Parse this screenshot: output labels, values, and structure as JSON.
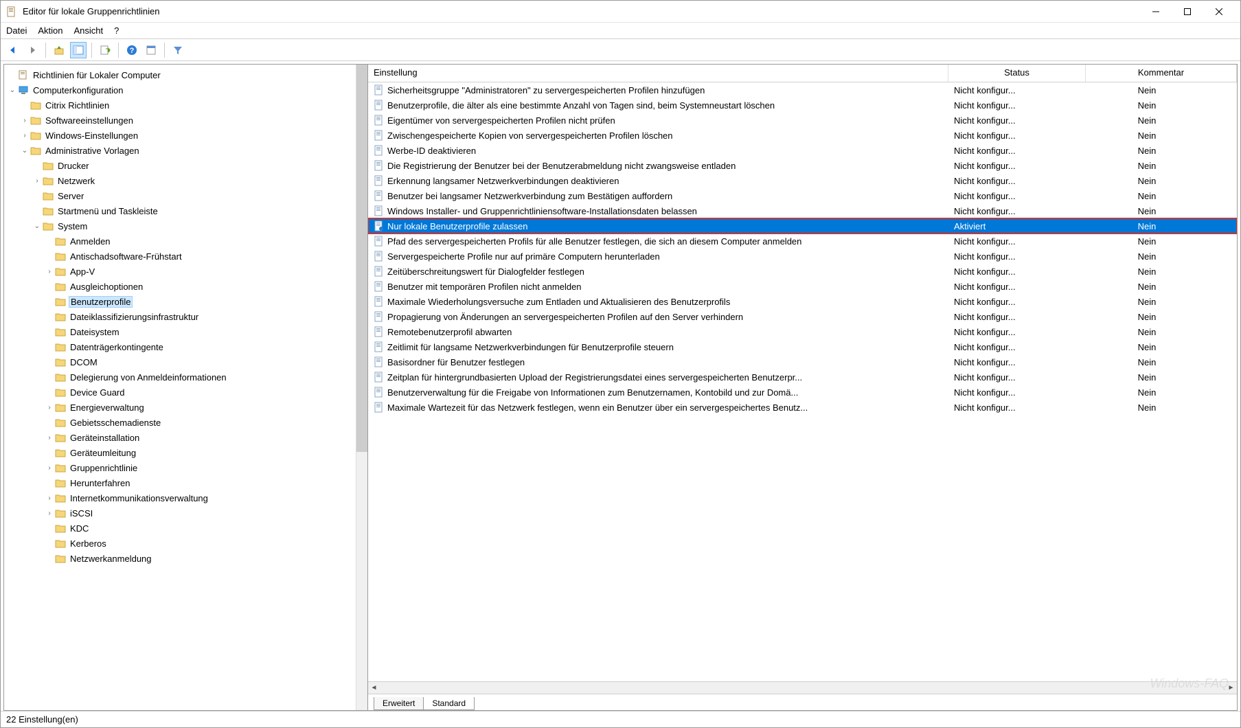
{
  "window": {
    "title": "Editor für lokale Gruppenrichtlinien"
  },
  "menu": {
    "file": "Datei",
    "action": "Aktion",
    "view": "Ansicht",
    "help": "?"
  },
  "tree": {
    "root": "Richtlinien für Lokaler Computer",
    "computerConfig": "Computerkonfiguration",
    "citrix": "Citrix Richtlinien",
    "software": "Softwareeinstellungen",
    "windowsSettings": "Windows-Einstellungen",
    "adminTemplates": "Administrative Vorlagen",
    "drucker": "Drucker",
    "netzwerk": "Netzwerk",
    "server": "Server",
    "startmenu": "Startmenü und Taskleiste",
    "system": "System",
    "anmelden": "Anmelden",
    "antischad": "Antischadsoftware-Frühstart",
    "appv": "App-V",
    "ausgleich": "Ausgleichoptionen",
    "benutzerprofile": "Benutzerprofile",
    "dateiklass": "Dateiklassifizierungsinfrastruktur",
    "dateisystem": "Dateisystem",
    "datentrager": "Datenträgerkontingente",
    "dcom": "DCOM",
    "delegierung": "Delegierung von Anmeldeinformationen",
    "deviceguard": "Device Guard",
    "energie": "Energieverwaltung",
    "gebiets": "Gebietsschemadienste",
    "gerateinst": "Geräteinstallation",
    "gerateuml": "Geräteumleitung",
    "gruppenricht": "Gruppenrichtlinie",
    "herunterfahren": "Herunterfahren",
    "internetkomm": "Internetkommunikationsverwaltung",
    "iscsi": "iSCSI",
    "kdc": "KDC",
    "kerberos": "Kerberos",
    "netzwerkanmeld": "Netzwerkanmeldung"
  },
  "columns": {
    "setting": "Einstellung",
    "status": "Status",
    "comment": "Kommentar"
  },
  "status": {
    "notConfigured": "Nicht konfigur...",
    "enabled": "Aktiviert",
    "no": "Nein"
  },
  "settings": [
    {
      "name": "Sicherheitsgruppe \"Administratoren\" zu servergespeicherten Profilen hinzufügen",
      "status": "nc"
    },
    {
      "name": "Benutzerprofile, die älter als eine bestimmte Anzahl von Tagen sind, beim Systemneustart löschen",
      "status": "nc"
    },
    {
      "name": "Eigentümer von servergespeicherten Profilen nicht prüfen",
      "status": "nc"
    },
    {
      "name": "Zwischengespeicherte Kopien von servergespeicherten Profilen löschen",
      "status": "nc"
    },
    {
      "name": "Werbe-ID deaktivieren",
      "status": "nc"
    },
    {
      "name": "Die Registrierung der Benutzer bei der Benutzerabmeldung nicht zwangsweise entladen",
      "status": "nc"
    },
    {
      "name": "Erkennung langsamer Netzwerkverbindungen deaktivieren",
      "status": "nc"
    },
    {
      "name": "Benutzer bei langsamer Netzwerkverbindung zum Bestätigen auffordern",
      "status": "nc"
    },
    {
      "name": "Windows Installer- und Gruppenrichtliniensoftware-Installationsdaten belassen",
      "status": "nc"
    },
    {
      "name": "Nur lokale Benutzerprofile zulassen",
      "status": "enabled",
      "selected": true
    },
    {
      "name": "Pfad des servergespeicherten Profils für alle Benutzer festlegen, die sich an diesem Computer anmelden",
      "status": "nc"
    },
    {
      "name": "Servergespeicherte Profile nur auf primäre Computern herunterladen",
      "status": "nc"
    },
    {
      "name": "Zeitüberschreitungswert für Dialogfelder festlegen",
      "status": "nc"
    },
    {
      "name": "Benutzer mit temporären Profilen nicht anmelden",
      "status": "nc"
    },
    {
      "name": "Maximale Wiederholungsversuche zum Entladen und Aktualisieren des Benutzerprofils",
      "status": "nc"
    },
    {
      "name": "Propagierung von Änderungen an servergespeicherten Profilen auf den Server verhindern",
      "status": "nc"
    },
    {
      "name": "Remotebenutzerprofil abwarten",
      "status": "nc"
    },
    {
      "name": "Zeitlimit für langsame Netzwerkverbindungen für Benutzerprofile steuern",
      "status": "nc"
    },
    {
      "name": "Basisordner für Benutzer festlegen",
      "status": "nc"
    },
    {
      "name": "Zeitplan für hintergrundbasierten Upload der Registrierungsdatei eines servergespeicherten Benutzerpr...",
      "status": "nc"
    },
    {
      "name": "Benutzerverwaltung für die Freigabe von Informationen zum Benutzernamen, Kontobild und zur Domä...",
      "status": "nc"
    },
    {
      "name": "Maximale Wartezeit für das Netzwerk festlegen, wenn ein Benutzer über ein servergespeichertes Benutz...",
      "status": "nc"
    }
  ],
  "tabs": {
    "extended": "Erweitert",
    "standard": "Standard"
  },
  "statusbar": "22 Einstellung(en)",
  "watermark": "Windows-FAQ"
}
